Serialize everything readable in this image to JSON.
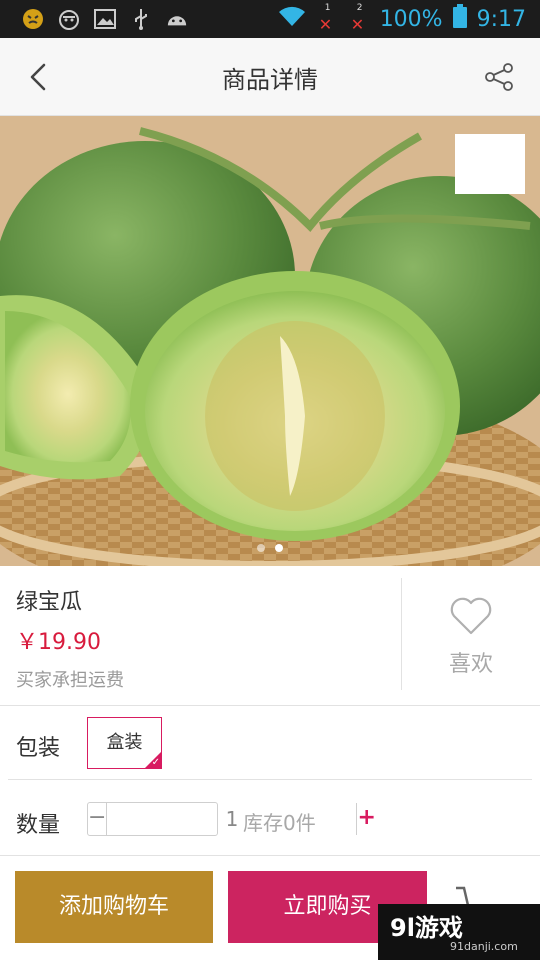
{
  "status_bar": {
    "battery_percent": "100%",
    "time": "9:17",
    "sim1_label": "1",
    "sim2_label": "2",
    "icons": [
      "emoji-icon",
      "face-icon",
      "image-icon",
      "usb-icon",
      "android-icon",
      "wifi-icon",
      "signal-icon",
      "battery-icon"
    ],
    "accent_color": "#33b5e5"
  },
  "header": {
    "title": "商品详情",
    "back_icon": "back-arrow-icon",
    "share_icon": "share-icon"
  },
  "gallery": {
    "image_subject": "melon-photo",
    "page_count": 2,
    "active_page": 2
  },
  "product": {
    "name": "绿宝瓜",
    "price": "￥19.90",
    "shipping_note": "买家承担运费",
    "like_label": "喜欢",
    "price_color": "#d81b3d"
  },
  "options": {
    "package_label": "包装",
    "package_value": "盒装",
    "quantity_label": "数量",
    "quantity_minus": "−",
    "quantity_value": "1",
    "quantity_plus": "+",
    "stock_text": "库存0件"
  },
  "actions": {
    "add_to_cart": "添加购物车",
    "buy_now": "立即购买",
    "cart_color": "#b98a2a",
    "buy_color": "#cc2460"
  },
  "watermark": {
    "brand": "9l游戏",
    "url": "91danji.com"
  }
}
